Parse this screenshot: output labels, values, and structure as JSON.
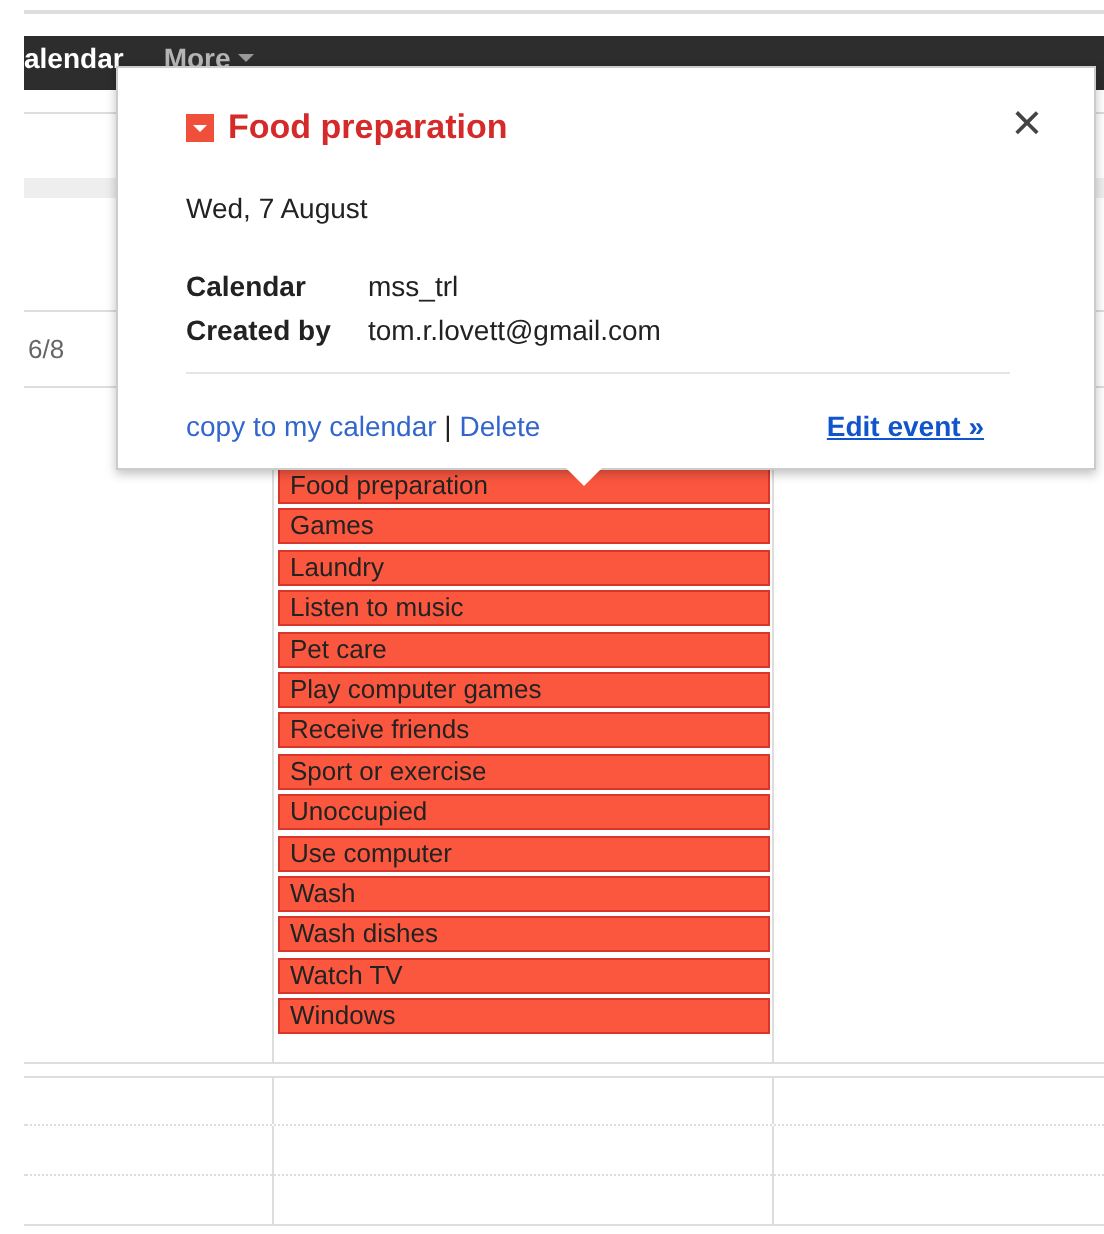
{
  "nav": {
    "items": [
      {
        "label": "alendar"
      },
      {
        "label": "More"
      }
    ]
  },
  "grid": {
    "date_label": "6/8"
  },
  "events": [
    {
      "title": "Food preparation"
    },
    {
      "title": "Games"
    },
    {
      "title": "Laundry"
    },
    {
      "title": "Listen to music"
    },
    {
      "title": "Pet care"
    },
    {
      "title": "Play computer games"
    },
    {
      "title": "Receive friends"
    },
    {
      "title": "Sport or exercise"
    },
    {
      "title": "Unoccupied"
    },
    {
      "title": "Use computer"
    },
    {
      "title": "Wash"
    },
    {
      "title": "Wash dishes"
    },
    {
      "title": "Watch TV"
    },
    {
      "title": "Windows"
    }
  ],
  "popup": {
    "title": "Food preparation",
    "date": "Wed, 7 August",
    "close": "×",
    "details": [
      {
        "label": "Calendar",
        "value": "mss_trl"
      },
      {
        "label": "Created by",
        "value": "tom.r.lovett@gmail.com"
      }
    ],
    "links": [
      {
        "label": "copy to my calendar"
      },
      {
        "label": "Delete"
      }
    ],
    "separator": "|",
    "edit_link": "Edit event »"
  }
}
